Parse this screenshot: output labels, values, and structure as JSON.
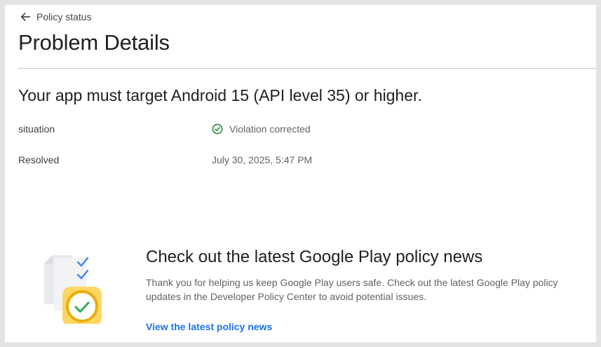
{
  "header": {
    "back_label": "Policy status",
    "page_title": "Problem Details"
  },
  "problem": {
    "title": "Your app must target Android 15 (API level 35) or higher.",
    "rows": [
      {
        "label": "situation",
        "value": "Violation corrected",
        "icon": "check-circle-icon",
        "icon_color": "#1e8e3e"
      },
      {
        "label": "Resolved",
        "value": "July 30, 2025, 5:47 PM"
      }
    ]
  },
  "news": {
    "illustration": "policy-checklist-illustration",
    "title": "Check out the latest Google Play policy news",
    "description": "Thank you for helping us keep Google Play users safe. Check out the latest Google Play policy updates in the Developer Policy Center to avoid potential issues.",
    "link_label": "View the latest policy news"
  },
  "colors": {
    "accent": "#1a73e8",
    "success": "#1e8e3e",
    "highlight_yellow": "#fdd663"
  }
}
